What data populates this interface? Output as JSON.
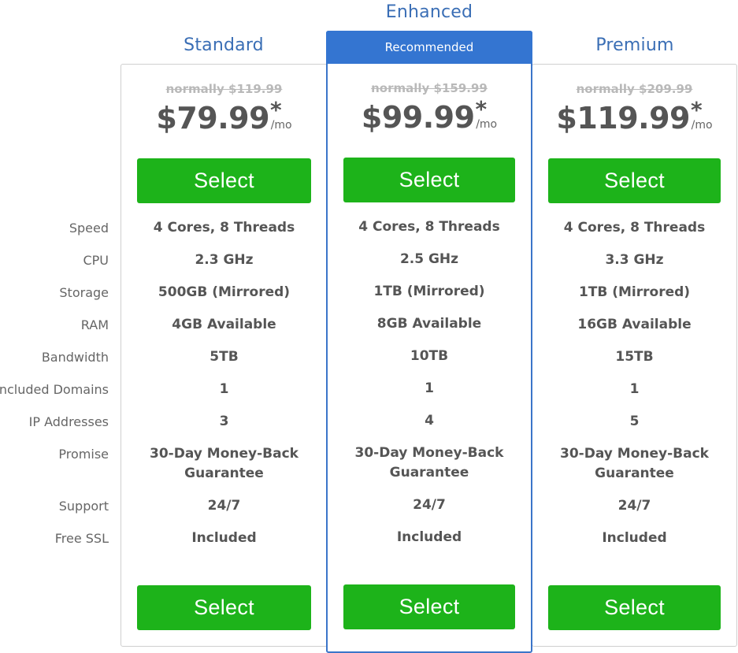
{
  "colors": {
    "title_blue": "#3a6eb5",
    "featured_blue": "#3475d1",
    "select_green": "#1db31a",
    "text_dark": "#555555",
    "strike_grey": "#b9b9b9"
  },
  "features": [
    "Speed",
    "CPU",
    "Storage",
    "RAM",
    "Bandwidth",
    "Included Domains",
    "IP Addresses",
    "Promise",
    "Support",
    "Free SSL"
  ],
  "plans": [
    {
      "name": "Standard",
      "normally": "normally $119.99",
      "price": "$79.99",
      "asterisk": "*",
      "per": "/mo",
      "select_label": "Select",
      "values": [
        "4 Cores, 8 Threads",
        "2.3 GHz",
        "500GB (Mirrored)",
        "4GB Available",
        "5TB",
        "1",
        "3",
        "30-Day Money-Back Guarantee",
        "24/7",
        "Included"
      ]
    },
    {
      "name": "Enhanced",
      "badge": "Recommended",
      "normally": "normally $159.99",
      "price": "$99.99",
      "asterisk": "*",
      "per": "/mo",
      "select_label": "Select",
      "values": [
        "4 Cores, 8 Threads",
        "2.5 GHz",
        "1TB (Mirrored)",
        "8GB Available",
        "10TB",
        "1",
        "4",
        "30-Day Money-Back Guarantee",
        "24/7",
        "Included"
      ]
    },
    {
      "name": "Premium",
      "normally": "normally $209.99",
      "price": "$119.99",
      "asterisk": "*",
      "per": "/mo",
      "select_label": "Select",
      "values": [
        "4 Cores, 8 Threads",
        "3.3 GHz",
        "1TB (Mirrored)",
        "16GB Available",
        "15TB",
        "1",
        "5",
        "30-Day Money-Back Guarantee",
        "24/7",
        "Included"
      ]
    }
  ]
}
